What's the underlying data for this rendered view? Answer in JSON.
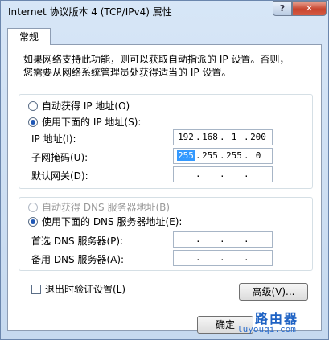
{
  "window": {
    "title": "Internet 协议版本 4 (TCP/IPv4) 属性",
    "help_glyph": "?",
    "close_glyph": "✕"
  },
  "tabs": [
    {
      "label": "常规"
    }
  ],
  "description": "如果网络支持此功能，则可以获取自动指派的 IP 设置。否则，您需要从网络系统管理员处获得适当的 IP 设置。",
  "ip_section": {
    "auto_label": "自动获得 IP 地址(O)",
    "manual_label": "使用下面的 IP 地址(S):",
    "selected": "manual",
    "ip_label": "IP 地址(I):",
    "ip_value": [
      "192",
      "168",
      "1",
      "200"
    ],
    "mask_label": "子网掩码(U):",
    "mask_value": [
      "255",
      "255",
      "255",
      "0"
    ],
    "gateway_label": "默认网关(D):",
    "gateway_value": [
      "",
      "",
      "",
      ""
    ]
  },
  "dns_section": {
    "auto_label": "自动获得 DNS 服务器地址(B)",
    "manual_label": "使用下面的 DNS 服务器地址(E):",
    "selected": "manual",
    "preferred_label": "首选 DNS 服务器(P):",
    "preferred_value": [
      "",
      "",
      "",
      ""
    ],
    "alternate_label": "备用 DNS 服务器(A):",
    "alternate_value": [
      "",
      "",
      "",
      ""
    ]
  },
  "validate_label": "退出时验证设置(L)",
  "advanced_button": "高级(V)...",
  "ok_button": "确定",
  "watermark": {
    "text": "路由器",
    "url": "luyouqi.com"
  }
}
